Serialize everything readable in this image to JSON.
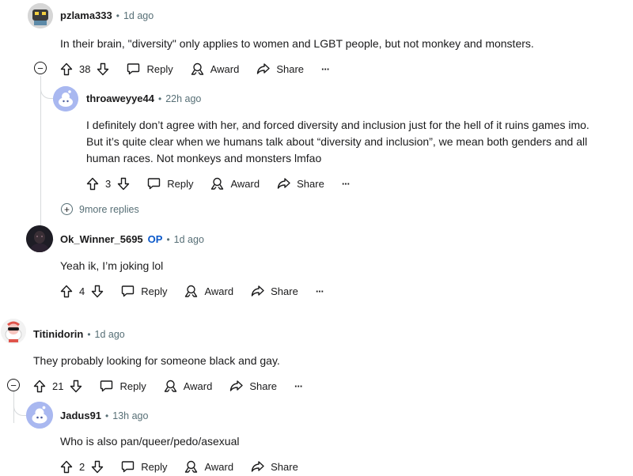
{
  "comments": [
    {
      "author": "pzlama333",
      "time": "1d ago",
      "body": [
        "In their brain, \"diversity\" only applies to women and LGBT people, but not monkey and monsters."
      ],
      "votes": "38"
    },
    {
      "author": "throaweyye44",
      "time": "22h ago",
      "body": [
        "I definitely don’t agree with her, and forced diversity and inclusion just for the hell of it ruins games imo.",
        "But it’s quite clear when we humans talk about “diversity and inclusion”, we mean both genders and all",
        "human races. Not monkeys and monsters lmfao"
      ],
      "votes": "3"
    },
    {
      "author": "Ok_Winner_5695",
      "op_badge": "OP",
      "time": "1d ago",
      "body": [
        "Yeah ik, I’m joking lol"
      ],
      "votes": "4"
    },
    {
      "author": "Titinidorin",
      "time": "1d ago",
      "body": [
        "They probably looking for someone black and gay."
      ],
      "votes": "21"
    },
    {
      "author": "Jadus91",
      "time": "13h ago",
      "body": [
        "Who is also pan/queer/pedo/asexual"
      ],
      "votes": "2"
    }
  ],
  "more_replies": "9more replies",
  "actions": {
    "reply": "Reply",
    "award": "Award",
    "share": "Share",
    "more": "···"
  },
  "separator": "•",
  "collapse_symbol": "−",
  "expand_symbol": "+",
  "icons": [
    "upvote-icon",
    "downvote-icon",
    "reply-icon",
    "award-icon",
    "share-icon",
    "more-icon",
    "collapse-icon",
    "expand-icon"
  ]
}
